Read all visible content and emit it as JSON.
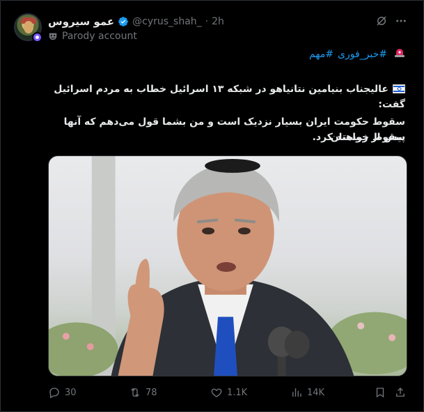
{
  "header": {
    "display_name": "عمو سیروس",
    "handle": "@cyrus_shah_",
    "separator": "·",
    "timestamp": "2h",
    "parody_label": "Parody account",
    "icons": [
      "parody-mask-icon",
      "verified-badge-icon",
      "grok-icon",
      "more-icon"
    ]
  },
  "tweet": {
    "hashtags": [
      "#خبر_فوری",
      "#مهم"
    ],
    "line1": "عالیجناب بنیامین نتانیاهو در شبکه ۱۳ اسرائیل خطاب به مردم اسرائیل گفت:",
    "line2": "سقوط حکومت ایران بسیار نزدیک است  و من بشما قول می‌دهم که آنها پیش از زمستان",
    "line3": "سقوط خواهند کرد."
  },
  "media": {
    "type": "photo"
  },
  "actions": {
    "replies": "30",
    "reposts": "78",
    "likes": "1.1K",
    "views": "14K"
  },
  "colors": {
    "background": "#000000",
    "text": "#e7e9ea",
    "muted": "#71767b",
    "link": "#1d9bf0",
    "verified": "#1d9bf0",
    "parody_badge": "#7856ff"
  }
}
